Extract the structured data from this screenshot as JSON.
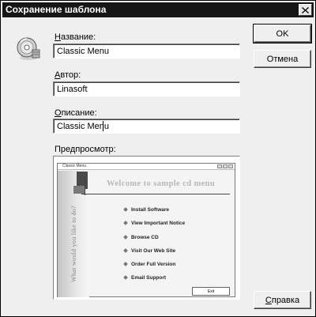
{
  "window": {
    "title": "Сохранение шаблона",
    "close_glyph": "close-icon"
  },
  "form": {
    "name_label_prefix": "Н",
    "name_label_rest": "азвание:",
    "name_value": "Classic Menu",
    "author_label_prefix": "А",
    "author_label_rest": "втор:",
    "author_value": "Linasoft",
    "description_label_prefix": "О",
    "description_label_rest": "писание:",
    "description_value": "Classic Menu",
    "preview_label": "Предпросмотр:"
  },
  "buttons": {
    "ok": "OK",
    "cancel": "Отмена",
    "help_prefix": "С",
    "help_rest": "правка"
  },
  "preview": {
    "window_title": "Classic Menu",
    "welcome": "Welcome to sample cd menu",
    "vertical_text": "What would you like to do?",
    "menu_items": [
      "Install Software",
      "View Important Notice",
      "Browse CD",
      "Visit Our Web Site",
      "Order Full Version",
      "Email Support"
    ],
    "exit_label": "Exit"
  },
  "colors": {
    "titlebar": "#161616",
    "dialog_bg": "#efefef"
  }
}
